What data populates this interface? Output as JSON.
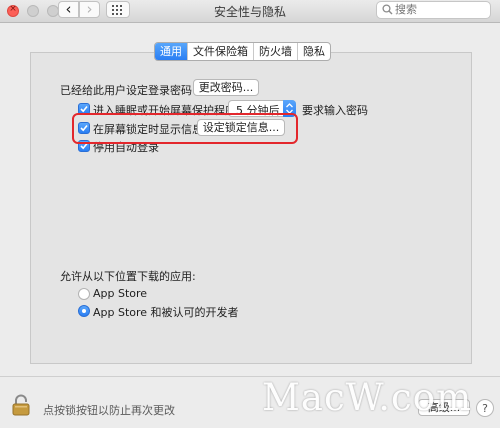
{
  "window": {
    "title": "安全性与隐私",
    "close_glyph": "×",
    "back_glyph": "‹",
    "forward_glyph": "›"
  },
  "search": {
    "placeholder": "搜索"
  },
  "tabs": [
    {
      "label": "通用",
      "active": true
    },
    {
      "label": "文件保险箱",
      "active": false
    },
    {
      "label": "防火墙",
      "active": false
    },
    {
      "label": "隐私",
      "active": false
    }
  ],
  "general": {
    "password_label": "已经给此用户设定登录密码",
    "change_password_button": "更改密码...",
    "require_password": {
      "checked": true,
      "label": "进入睡眠或开始屏幕保护程序",
      "delay_value": "5 分钟后",
      "suffix": "要求输入密码"
    },
    "lock_message": {
      "checked": true,
      "label": "在屏幕锁定时显示信息",
      "button": "设定锁定信息..."
    },
    "disable_autologin": {
      "checked": true,
      "label": "停用自动登录"
    },
    "downloads": {
      "heading": "允许从以下位置下载的应用:",
      "options": [
        {
          "label": "App Store",
          "selected": false
        },
        {
          "label": "App Store 和被认可的开发者",
          "selected": true
        }
      ]
    }
  },
  "footer": {
    "lock_text": "点按锁按钮以防止再次更改",
    "advanced_button": "高级..."
  },
  "watermark": "MacW.com",
  "colors": {
    "accent": "#2a7ef3",
    "highlight": "#e3272c",
    "close_light": "#fc5f57"
  }
}
